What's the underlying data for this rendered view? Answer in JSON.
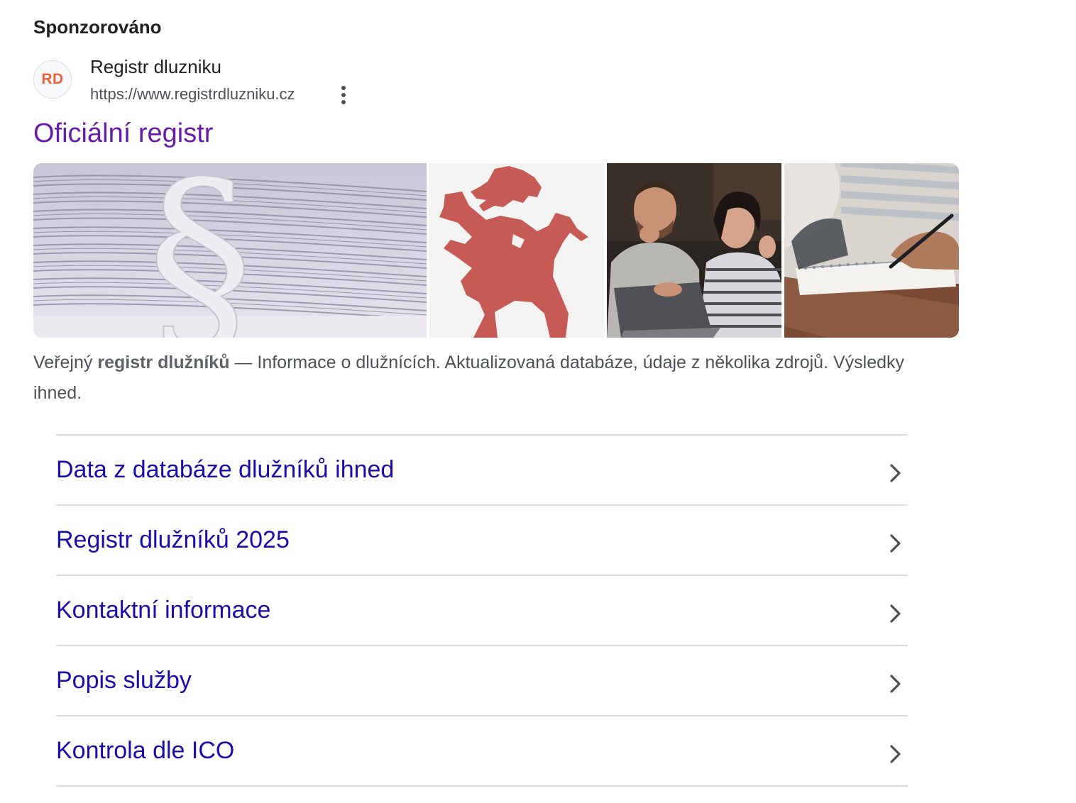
{
  "sponsored_label": "Sponzorováno",
  "advertiser": {
    "logo_text": "RD",
    "logo_color": "#e8623d",
    "name": "Registr dluzniku",
    "url": "https://www.registrdluzniku.cz",
    "menu_icon": "more-vert-icon"
  },
  "ad": {
    "title": "Oficiální registr",
    "title_color": "#681da8",
    "description": {
      "prefix": "Veřejný ",
      "bold": "registr dlužníků",
      "suffix": " — Informace o dlužnících. Aktualizovaná databáze, údaje z několika zdrojů. Výsledky ihned."
    }
  },
  "images": [
    {
      "name": "paper-stack-paragraph-image"
    },
    {
      "name": "red-lion-logo-image",
      "color": "#c65a55"
    },
    {
      "name": "couple-with-laptop-image"
    },
    {
      "name": "hand-writing-notebook-image"
    }
  ],
  "sitelinks": [
    {
      "label": "Data z databáze dlužníků ihned"
    },
    {
      "label": "Registr dlužníků 2025"
    },
    {
      "label": "Kontaktní informace"
    },
    {
      "label": "Popis služby"
    },
    {
      "label": "Kontrola dle ICO"
    }
  ],
  "link_color": "#1a0dab"
}
